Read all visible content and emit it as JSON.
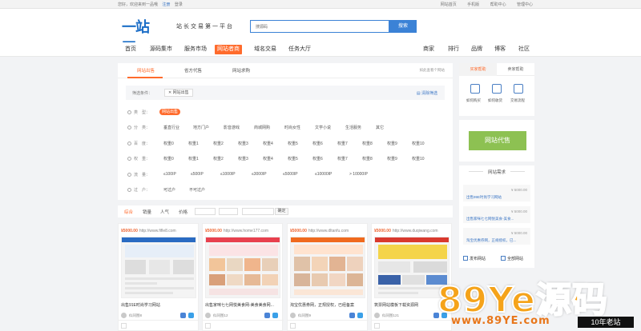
{
  "topbar": {
    "greeting": "您好，欢迎来到一品哦",
    "register": "注册",
    "login": "登录",
    "links": [
      "网站首页",
      "手机版",
      "帮助中心",
      "管理中心"
    ]
  },
  "header": {
    "logo": "一站网",
    "slogan": "站长交易第一平台",
    "search_value": "搜源码",
    "search_button": "搜索"
  },
  "nav": {
    "left": [
      "首页",
      "源码集市",
      "服务市场",
      "网站者商",
      "域名交易",
      "任务大厅"
    ],
    "right": [
      "商家",
      "排行",
      "品牌",
      "博客",
      "社区"
    ]
  },
  "tabs": {
    "items": [
      "网站出售",
      "省方代售",
      "网站求购"
    ],
    "how": "如此查看个网站"
  },
  "filter": {
    "label": "筛选条件：",
    "chip": "网站出售",
    "clear": "清除筛选"
  },
  "rows": [
    {
      "label": "类　型：",
      "options": [
        "网站出售"
      ],
      "selected": 0
    },
    {
      "label": "分　类：",
      "options": [
        "垂直行业",
        "地方门户",
        "影音游戏",
        "商城网购",
        "时尚女性",
        "文学小说",
        "生活服务",
        "其它"
      ]
    },
    {
      "label": "百　度：",
      "options": [
        "权重0",
        "权重1",
        "权重2",
        "权重3",
        "权重4",
        "权重5",
        "权重6",
        "权重7",
        "权重8",
        "权重9",
        "权重10"
      ]
    },
    {
      "label": "权　重：",
      "options": [
        "权重0",
        "权重1",
        "权重2",
        "权重3",
        "权重4",
        "权重5",
        "权重6",
        "权重7",
        "权重8",
        "权重9",
        "权重10"
      ]
    },
    {
      "label": "流　量：",
      "options": [
        "≤100IP",
        "≤500IP",
        "≤1000IP",
        "≤3000IP",
        "≤5000IP",
        "≤10000IP",
        "> 10000IP"
      ]
    },
    {
      "label": "过　户：",
      "options": [
        "可过户",
        "不可过户"
      ]
    }
  ],
  "sort": {
    "items": [
      "综合",
      "销量",
      "人气",
      "价格"
    ],
    "confirm": "确定"
  },
  "cards": [
    {
      "price": "¥5000.00",
      "url": "http://www.fifle8.com",
      "title": "出售91E时尚学习网站",
      "seller": "似同图8"
    },
    {
      "price": "¥5000.00",
      "url": "http://www.home177.com",
      "title": "出售家咪七七网悦美食网-美食美食网...",
      "seller": "似同图12"
    },
    {
      "price": "¥5000.00",
      "url": "http://www.dltanfu.com",
      "title": "淘宝优惠券网，正规授权，已经备案",
      "seller": "似同图9"
    },
    {
      "price": "¥5000.00",
      "url": "http://www.duqiwang.com",
      "title": "筑票网站模板下载资源网",
      "seller": "似同图121"
    }
  ],
  "sidebar": {
    "tabs": [
      "买家帮助",
      "卖家帮助"
    ],
    "help": [
      "如何购买",
      "如何收货",
      "交易流程"
    ],
    "sell_button": "网站代售",
    "demand_title": "网站需求",
    "demands": [
      {
        "price": "¥ 5000.00",
        "name": "出售99E时尚学习网站"
      },
      {
        "price": "¥ 5000.00",
        "name": "出售家咪七七网悦美食-美食..."
      },
      {
        "price": "¥ 5000.00",
        "name": "淘宝优惠券网，正规授权，已..."
      }
    ],
    "actions": [
      "发布网站",
      "全部网站"
    ]
  },
  "watermark": {
    "brand": "89Ye",
    "brand_cn": "源码",
    "url": "www.89YE.com",
    "tag": "10年老站"
  },
  "colors": {
    "accent": "#ff6b2c",
    "primary": "#3b82d6",
    "green": "#8dc152"
  }
}
